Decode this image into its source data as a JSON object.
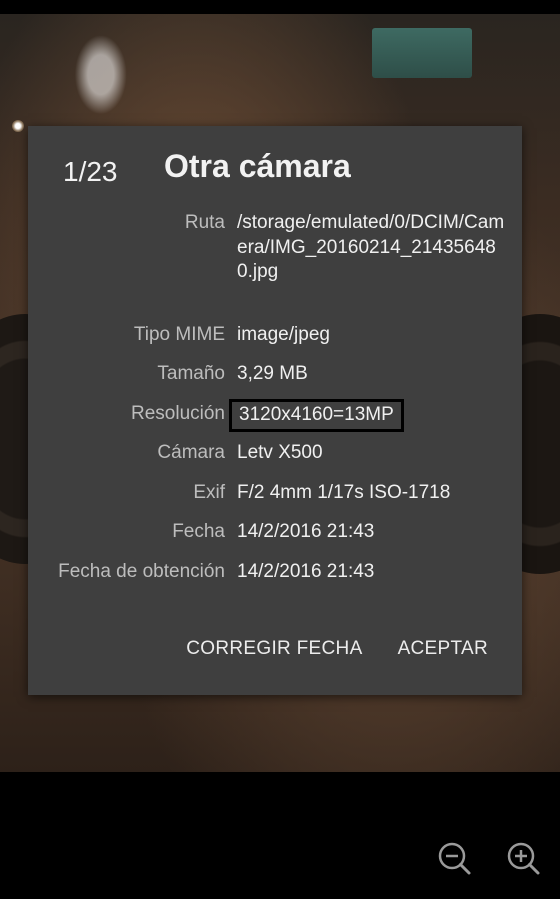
{
  "dialog": {
    "counter": "1/23",
    "title": "Otra cámara",
    "rows": [
      {
        "label": "Ruta",
        "value": "/storage/emulated/0/DCIM/Camera/IMG_20160214_214356480.jpg"
      },
      {
        "label": "Tipo MIME",
        "value": "image/jpeg"
      },
      {
        "label": "Tamaño",
        "value": "3,29 MB"
      },
      {
        "label": "Resolución",
        "value": "3120x4160=13MP"
      },
      {
        "label": "Cámara",
        "value": "Letv X500"
      },
      {
        "label": "Exif",
        "value": "F/2 4mm 1/17s ISO-1718"
      },
      {
        "label": "Fecha",
        "value": "14/2/2016 21:43"
      },
      {
        "label": "Fecha de obtención",
        "value": "14/2/2016 21:43"
      }
    ],
    "buttons": {
      "fix_date": "CORREGIR FECHA",
      "accept": "ACEPTAR"
    }
  },
  "controls": {
    "zoom_out_icon": "zoom-out-icon",
    "zoom_in_icon": "zoom-in-icon"
  },
  "colors": {
    "dialog_bg": "#3f3f3f",
    "label": "#bdbdbd",
    "value": "#f0f0f0",
    "highlight_border": "#000000"
  }
}
